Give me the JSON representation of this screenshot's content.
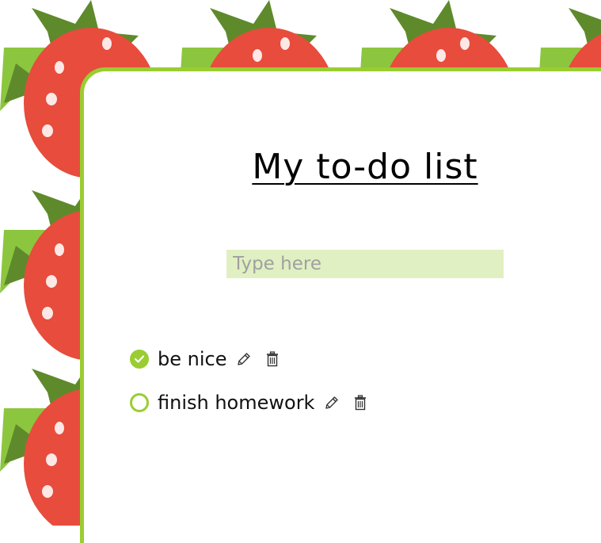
{
  "page": {
    "title": "My to-do list"
  },
  "input": {
    "placeholder": "Type here",
    "value": ""
  },
  "todos": [
    {
      "label": "be nice",
      "done": true
    },
    {
      "label": "finish homework",
      "done": false
    }
  ],
  "icons": {
    "check": "check-circle-icon",
    "edit": "pencil-icon",
    "delete": "trash-icon"
  },
  "colors": {
    "accent": "#9acd32",
    "input_bg": "#e1f0c2",
    "strawberry": "#e74c3c",
    "leaf_dark": "#5e8a2c",
    "leaf_light": "#8cc63f"
  }
}
